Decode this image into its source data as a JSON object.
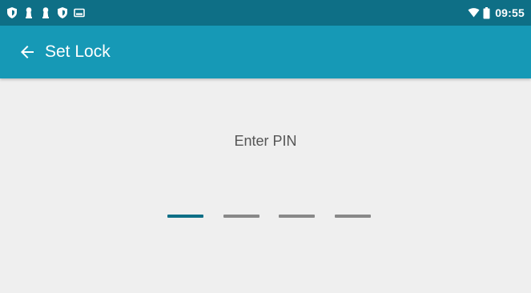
{
  "status_bar": {
    "left_icons": [
      "shield-icon",
      "keyhole-icon",
      "keyhole-icon",
      "shield-icon",
      "image-icon"
    ],
    "wifi_icon": "wifi-icon",
    "battery_icon": "battery-icon",
    "time": "09:55"
  },
  "app_bar": {
    "back_icon": "arrow-back-icon",
    "title": "Set Lock"
  },
  "main": {
    "prompt": "Enter PIN",
    "pin_digits": 4,
    "active_slot": 0
  },
  "colors": {
    "status_bar": "#0e6f86",
    "app_bar": "#1699b6",
    "background": "#efefef",
    "active_slot": "#0e6f86",
    "inactive_slot": "#888888"
  }
}
